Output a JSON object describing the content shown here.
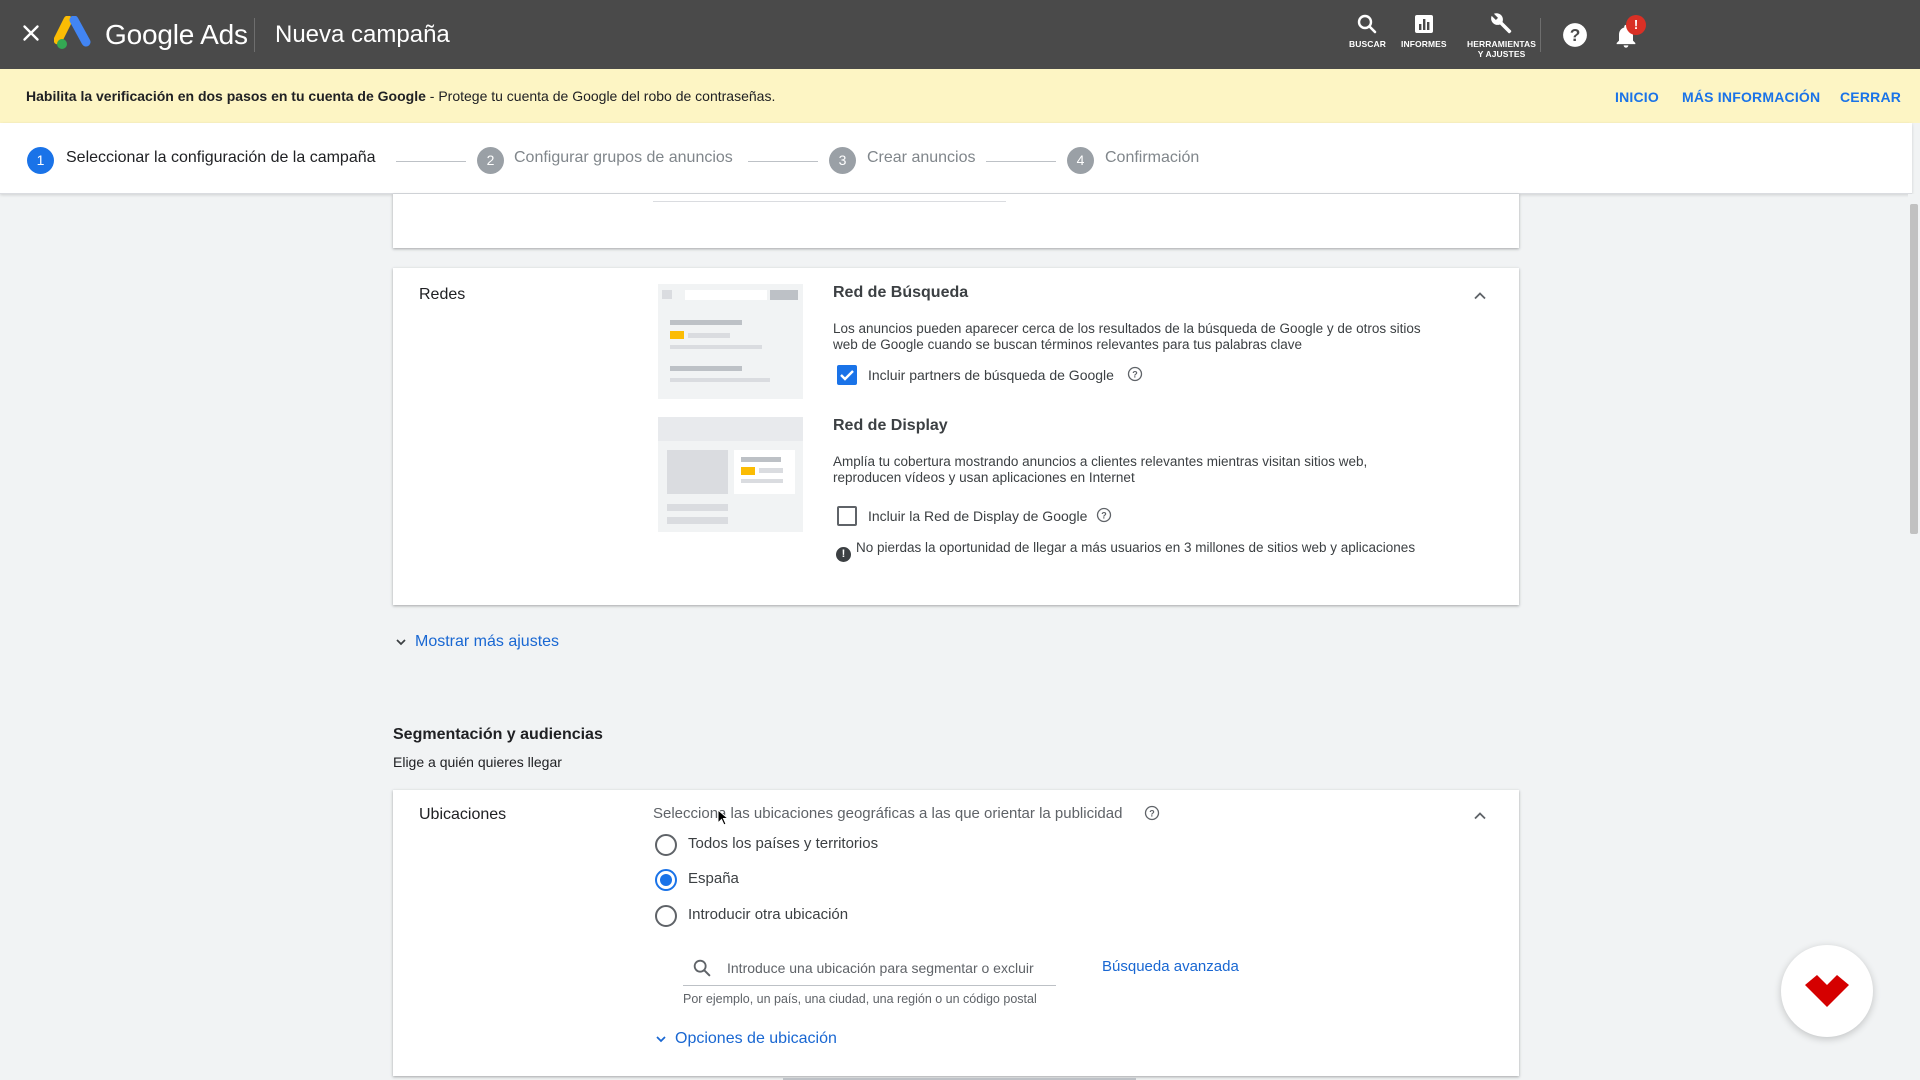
{
  "topbar": {
    "brand": "Google Ads",
    "page_title": "Nueva campaña",
    "search_label": "BUSCAR",
    "reports_label": "INFORMES",
    "tools_label_1": "HERRAMIENTAS",
    "tools_label_2": "Y AJUSTES",
    "notification_badge": "!"
  },
  "banner": {
    "bold_text": "Habilita la verificación en dos pasos en tu cuenta de Google",
    "text": " - Protege tu cuenta de Google del robo de contraseñas.",
    "links": [
      "INICIO",
      "MÁS INFORMACIÓN",
      "CERRAR"
    ]
  },
  "stepper": {
    "steps": [
      {
        "number": "1",
        "label": "Seleccionar la configuración de la campaña",
        "active": true
      },
      {
        "number": "2",
        "label": "Configurar grupos de anuncios",
        "active": false
      },
      {
        "number": "3",
        "label": "Crear anuncios",
        "active": false
      },
      {
        "number": "4",
        "label": "Confirmación",
        "active": false
      }
    ]
  },
  "redes": {
    "title": "Redes",
    "search_network": {
      "title": "Red de Búsqueda",
      "description": "Los anuncios pueden aparecer cerca de los resultados de la búsqueda de Google y de otros sitios web de Google cuando se buscan términos relevantes para tus palabras clave",
      "checkbox_label": "Incluir partners de búsqueda de Google",
      "checked": true
    },
    "display_network": {
      "title": "Red de Display",
      "description": "Amplía tu cobertura mostrando anuncios a clientes relevantes mientras visitan sitios web, reproducen vídeos y usan aplicaciones en Internet",
      "checkbox_label": "Incluir la Red de Display de Google",
      "checked": false,
      "warning": "No pierdas la oportunidad de llegar a más usuarios en 3 millones de sitios web y aplicaciones"
    }
  },
  "more_settings": "Mostrar más ajustes",
  "targeting": {
    "title": "Segmentación y audiencias",
    "subtitle": "Elige a quién quieres llegar"
  },
  "ubicaciones": {
    "title": "Ubicaciones",
    "prompt": "Selecciona las ubicaciones geográficas a las que orientar la publicidad",
    "options": [
      {
        "label": "Todos los países y territorios",
        "selected": false
      },
      {
        "label": "España",
        "selected": true
      },
      {
        "label": "Introducir otra ubicación",
        "selected": false
      }
    ],
    "search_placeholder": "Introduce una ubicación para segmentar o excluir",
    "advanced_search": "Búsqueda avanzada",
    "hint": "Por ejemplo, un país, una ciudad, una región o un código postal",
    "location_options": "Opciones de ubicación"
  },
  "colors": {
    "accent": "#1a73e8",
    "link": "#1967d2",
    "topbar": "#4a4a4a",
    "banner": "#fdf5c4",
    "badge": "#d93025",
    "yellow": "#fbbc04"
  }
}
